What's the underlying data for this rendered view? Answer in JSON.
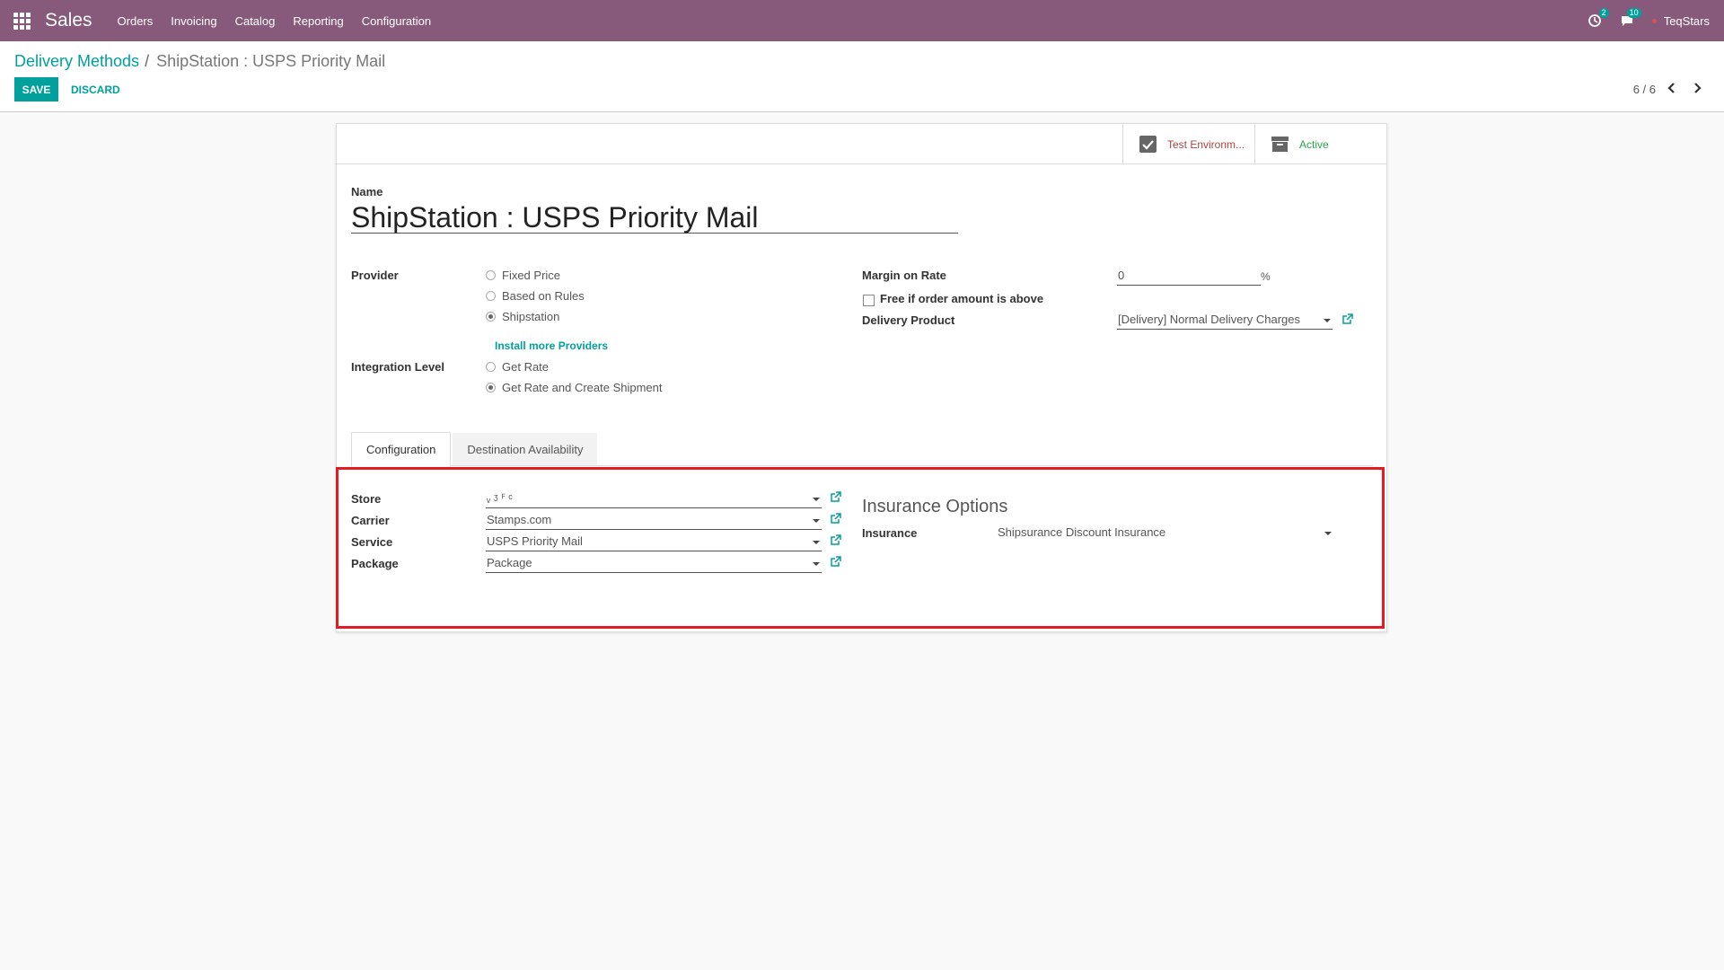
{
  "navbar": {
    "brand": "Sales",
    "menu": [
      "Orders",
      "Invoicing",
      "Catalog",
      "Reporting",
      "Configuration"
    ],
    "activity_badge": "2",
    "messages_badge": "10",
    "user": "TeqStars",
    "bg_color": "#875a7b"
  },
  "control_panel": {
    "breadcrumb_parent": "Delivery Methods",
    "breadcrumb_separator": "/",
    "breadcrumb_current": "ShipStation : USPS Priority Mail",
    "save_label": "SAVE",
    "discard_label": "DISCARD",
    "pager": "6 / 6"
  },
  "button_box": {
    "test_env": "Test Environm...",
    "active": "Active"
  },
  "form": {
    "name_label": "Name",
    "name_value": "ShipStation : USPS Priority Mail",
    "provider_label": "Provider",
    "provider_options": [
      {
        "label": "Fixed Price",
        "checked": false
      },
      {
        "label": "Based on Rules",
        "checked": false
      },
      {
        "label": "Shipstation",
        "checked": true
      }
    ],
    "install_more": "Install more Providers",
    "integration_label": "Integration Level",
    "integration_options": [
      {
        "label": "Get Rate",
        "checked": false
      },
      {
        "label": "Get Rate and Create Shipment",
        "checked": true
      }
    ],
    "margin_label": "Margin on Rate",
    "margin_value": "0",
    "margin_unit": "%",
    "free_label": "Free if order amount is above",
    "delivery_product_label": "Delivery Product",
    "delivery_product_value": "[Delivery] Normal Delivery Charges"
  },
  "tabs": {
    "configuration": "Configuration",
    "destination": "Destination Availability"
  },
  "config": {
    "store_label": "Store",
    "store_value": "ᵥ  ᶾ  ꟳ  ᶜ",
    "carrier_label": "Carrier",
    "carrier_value": "Stamps.com",
    "service_label": "Service",
    "service_value": "USPS Priority Mail",
    "package_label": "Package",
    "package_value": "Package",
    "insurance_title": "Insurance Options",
    "insurance_label": "Insurance",
    "insurance_value": "Shipsurance Discount Insurance"
  },
  "colors": {
    "accent": "#00a09d",
    "highlight": "#e31b23"
  }
}
